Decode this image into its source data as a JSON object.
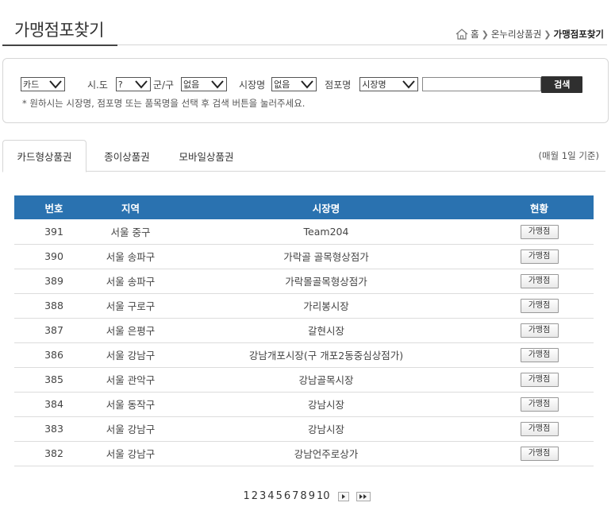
{
  "header": {
    "title": "가맹점포찾기",
    "breadcrumb": {
      "home": "홈",
      "section": "온누리상품권",
      "current": "가맹점포찾기"
    }
  },
  "search": {
    "card_select": "카드",
    "sido_label": "시.도",
    "sido_select": "?",
    "gungu_label": "군/구",
    "gungu_select": "없음",
    "market_label": "시장명",
    "market_select": "없음",
    "store_label": "점포명",
    "store_select": "시장명",
    "keyword_value": "",
    "button_label": "검색",
    "note": "* 원하시는 시장명, 점포명 또는 품목명을 선택 후 검색 버튼을 눌러주세요."
  },
  "tabs": [
    {
      "label": "카드형상품권"
    },
    {
      "label": "종이상품권"
    },
    {
      "label": "모바일상품권"
    }
  ],
  "tab_note": "(매월 1일 기준)",
  "table": {
    "headers": {
      "no": "번호",
      "region": "지역",
      "market": "시장명",
      "status": "현황"
    },
    "rows": [
      {
        "no": "391",
        "region": "서울 중구",
        "market": "Team204",
        "status": "가맹점"
      },
      {
        "no": "390",
        "region": "서울 송파구",
        "market": "가락골 골목형상점가",
        "status": "가맹점"
      },
      {
        "no": "389",
        "region": "서울 송파구",
        "market": "가락몰골목형상점가",
        "status": "가맹점"
      },
      {
        "no": "388",
        "region": "서울 구로구",
        "market": "가리봉시장",
        "status": "가맹점"
      },
      {
        "no": "387",
        "region": "서울 은평구",
        "market": "갈현시장",
        "status": "가맹점"
      },
      {
        "no": "386",
        "region": "서울 강남구",
        "market": "강남개포시장(구 개포2동중심상점가)",
        "status": "가맹점"
      },
      {
        "no": "385",
        "region": "서울 관악구",
        "market": "강남골목시장",
        "status": "가맹점"
      },
      {
        "no": "384",
        "region": "서울 동작구",
        "market": "강남시장",
        "status": "가맹점"
      },
      {
        "no": "383",
        "region": "서울 강남구",
        "market": "강남시장",
        "status": "가맹점"
      },
      {
        "no": "382",
        "region": "서울 강남구",
        "market": "강남언주로상가",
        "status": "가맹점"
      }
    ]
  },
  "pagination": {
    "pages": [
      "1",
      "2",
      "3",
      "4",
      "5",
      "6",
      "7",
      "8",
      "9",
      "10"
    ],
    "next_icon": "next-icon",
    "last_icon": "last-icon"
  },
  "colors": {
    "table_header": "#2a72b0",
    "search_button": "#2f2f2f"
  }
}
